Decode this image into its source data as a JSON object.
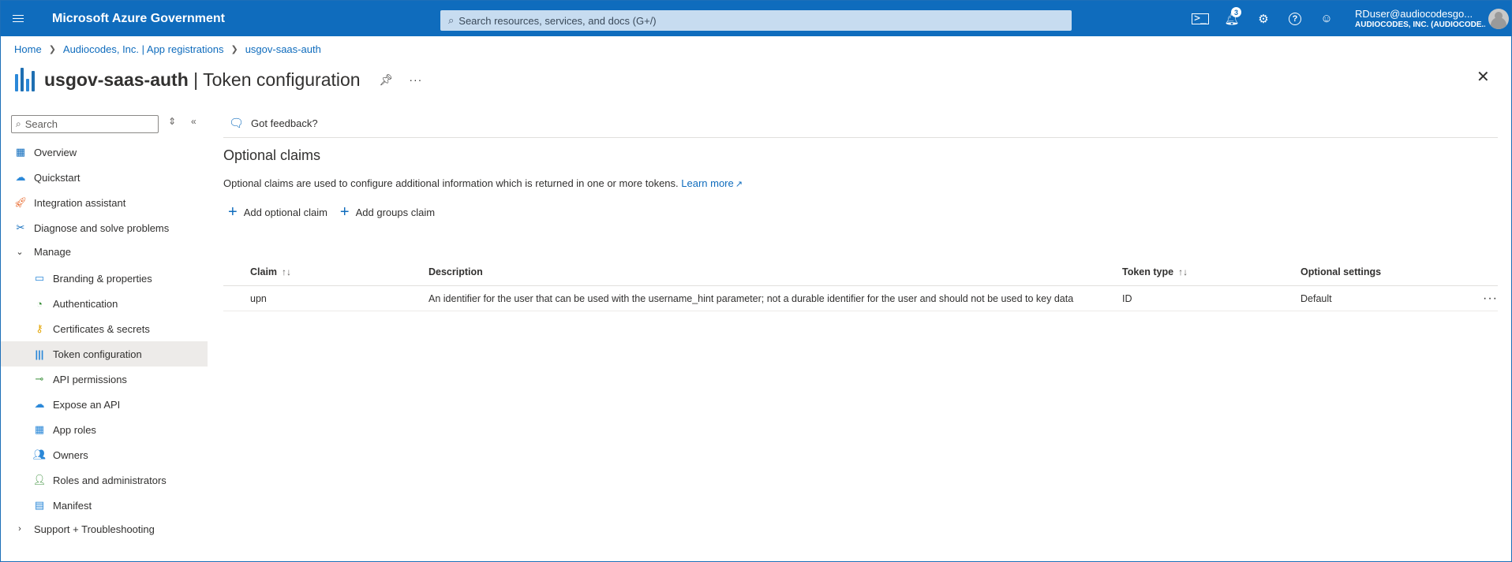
{
  "topbar": {
    "brand": "Microsoft Azure Government",
    "search_placeholder": "Search resources, services, and docs (G+/)",
    "notification_count": "3",
    "user_name": "RDuser@audiocodesgo...",
    "user_org": "AUDIOCODES, INC. (AUDIOCODE..."
  },
  "breadcrumb": {
    "items": [
      "Home",
      "Audiocodes, Inc. | App registrations",
      "usgov-saas-auth"
    ]
  },
  "title": {
    "app_name": "usgov-saas-auth",
    "separator": " | ",
    "page": "Token configuration"
  },
  "sidebar": {
    "search_placeholder": "Search",
    "items": [
      {
        "label": "Overview",
        "icon": "overview-grid-icon"
      },
      {
        "label": "Quickstart",
        "icon": "quickstart-cloud-icon"
      },
      {
        "label": "Integration assistant",
        "icon": "rocket-icon"
      },
      {
        "label": "Diagnose and solve problems",
        "icon": "wrench-icon"
      },
      {
        "label": "Manage",
        "icon": "chevron-down-icon"
      },
      {
        "label": "Branding & properties",
        "icon": "branding-icon"
      },
      {
        "label": "Authentication",
        "icon": "authentication-icon"
      },
      {
        "label": "Certificates & secrets",
        "icon": "key-icon"
      },
      {
        "label": "Token configuration",
        "icon": "token-bars-icon"
      },
      {
        "label": "API permissions",
        "icon": "api-permissions-icon"
      },
      {
        "label": "Expose an API",
        "icon": "cloud-api-icon"
      },
      {
        "label": "App roles",
        "icon": "app-roles-grid-icon"
      },
      {
        "label": "Owners",
        "icon": "owners-icon"
      },
      {
        "label": "Roles and administrators",
        "icon": "roles-admin-icon"
      },
      {
        "label": "Manifest",
        "icon": "manifest-icon"
      },
      {
        "label": "Support + Troubleshooting",
        "icon": "chevron-right-icon"
      }
    ]
  },
  "main": {
    "feedback_label": "Got feedback?",
    "section_title": "Optional claims",
    "section_desc": "Optional claims are used to configure additional information which is returned in one or more tokens.",
    "learn_more": "Learn more",
    "add_optional_claim": "Add optional claim",
    "add_groups_claim": "Add groups claim",
    "table": {
      "headers": [
        "Claim",
        "Description",
        "Token type",
        "Optional settings"
      ],
      "rows": [
        {
          "claim": "upn",
          "description": "An identifier for the user that can be used with the username_hint parameter; not a durable identifier for the user and should not be used to key data",
          "token_type": "ID",
          "optional_settings": "Default"
        }
      ]
    }
  },
  "colors": {
    "accent": "#0f6cbd",
    "active_nav": "#edebe9"
  }
}
